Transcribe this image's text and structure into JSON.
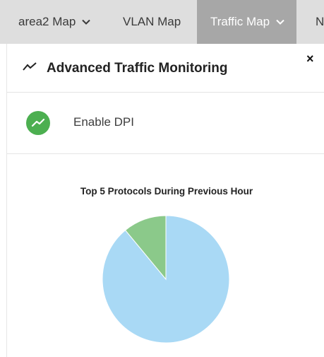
{
  "tabs": [
    {
      "label": "area2 Map",
      "has_dropdown": true,
      "active": false
    },
    {
      "label": "VLAN Map",
      "has_dropdown": false,
      "active": false
    },
    {
      "label": "Traffic Map",
      "has_dropdown": true,
      "active": true
    },
    {
      "label": "N",
      "has_dropdown": false,
      "active": false
    }
  ],
  "panel": {
    "title": "Advanced Traffic Monitoring",
    "title_icon": "trend-line-icon",
    "close_icon": "close-icon",
    "close_glyph": "×"
  },
  "dpi": {
    "label": "Enable DPI",
    "enabled": true,
    "icon": "trend-check-icon"
  },
  "colors": {
    "tabbar_bg": "#dedede",
    "active_tab_bg": "#a7a7a7",
    "toggle_on": "#4caf50",
    "slice_main": "#a9d9f5",
    "slice_secondary": "#8bc98a"
  },
  "chart_data": {
    "type": "pie",
    "title": "Top 5 Protocols During Previous Hour",
    "values": [
      89,
      11
    ],
    "colors": [
      "#a9d9f5",
      "#8bc98a"
    ]
  }
}
